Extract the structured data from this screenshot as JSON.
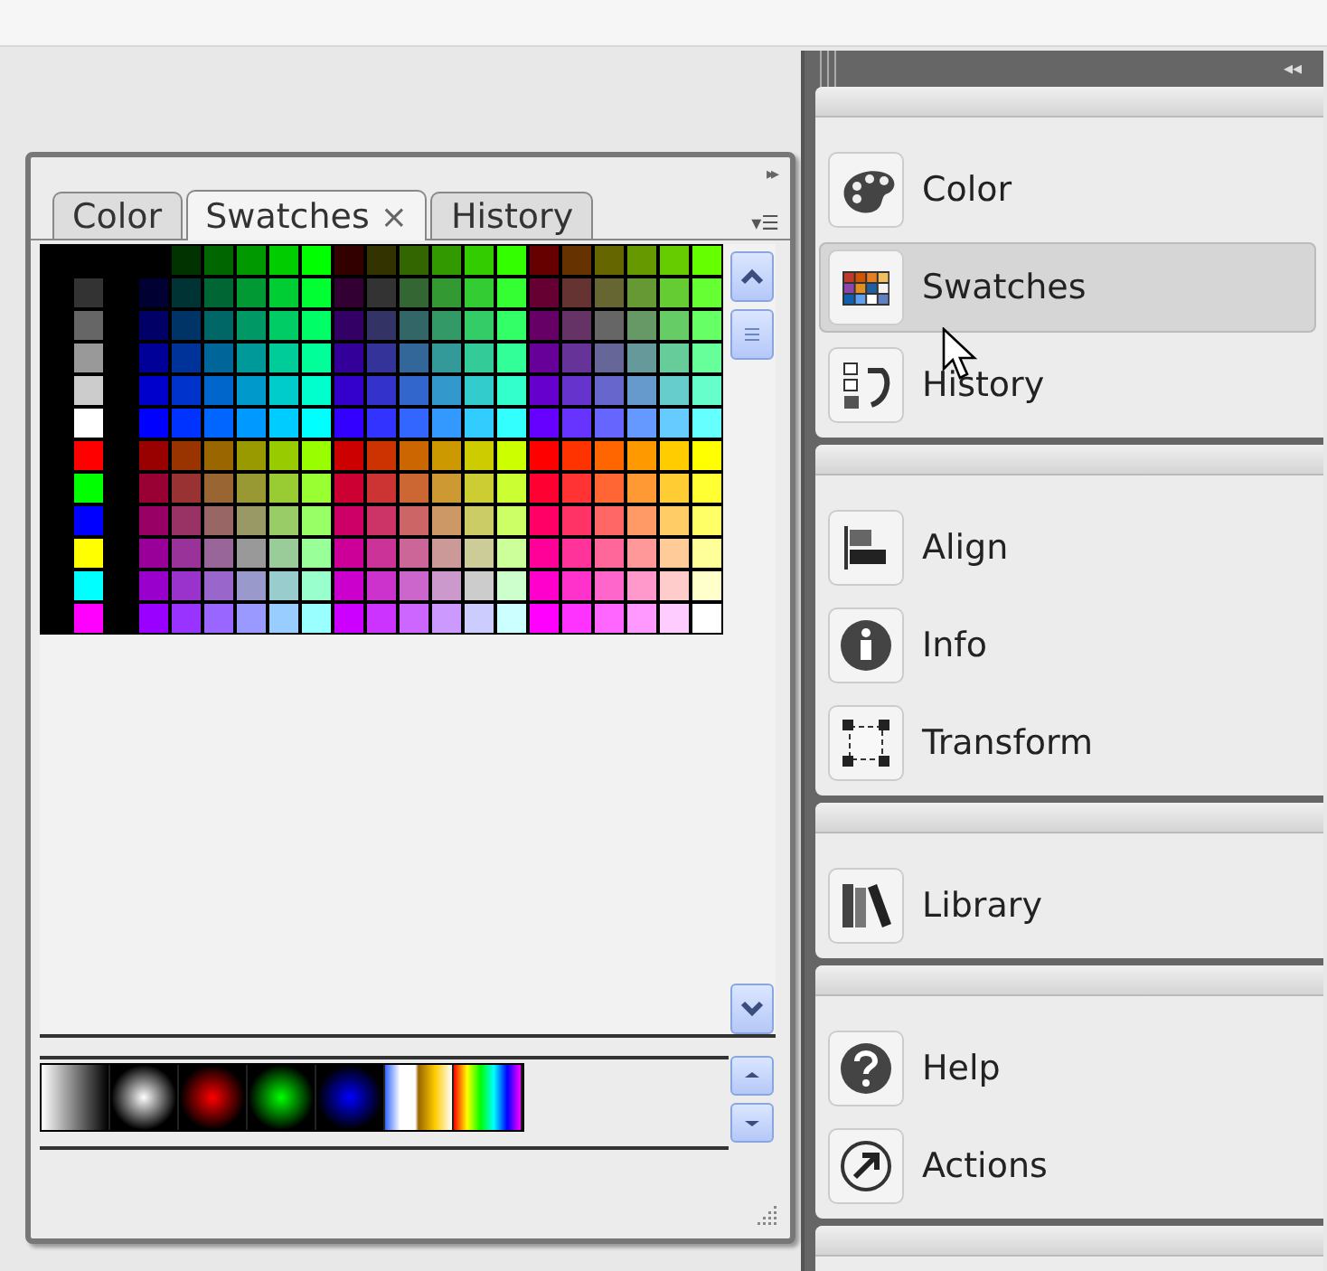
{
  "swatches_panel": {
    "collapse_glyph": "▸▸",
    "menu_glyph": "▾☰",
    "tabs": [
      {
        "label": "Color",
        "selected": false
      },
      {
        "label": "Swatches",
        "selected": true,
        "close": "×"
      },
      {
        "label": "History",
        "selected": false
      }
    ],
    "swatch_rows": [
      {
        "swatches": [
          {
            "color": "#003300"
          },
          {
            "color": "#006600"
          },
          {
            "color": "#009900"
          },
          {
            "color": "#00cc00"
          },
          {
            "color": "#00ff00"
          },
          {
            "color": "#330000"
          },
          {
            "color": "#333300"
          },
          {
            "color": "#336600"
          },
          {
            "color": "#339900"
          },
          {
            "color": "#33cc00"
          },
          {
            "color": "#33ff00"
          },
          {
            "color": "#660000"
          },
          {
            "color": "#663300"
          },
          {
            "color": "#666600"
          },
          {
            "color": "#669900"
          },
          {
            "color": "#66cc00"
          },
          {
            "color": "#66ff00"
          }
        ]
      },
      {
        "side": {
          "color": "#333333"
        },
        "swatches": [
          {
            "color": "#000033"
          },
          {
            "color": "#003333"
          },
          {
            "color": "#006633"
          },
          {
            "color": "#009933"
          },
          {
            "color": "#00cc33"
          },
          {
            "color": "#00ff33"
          },
          {
            "color": "#330033"
          },
          {
            "color": "#333333"
          },
          {
            "color": "#336633"
          },
          {
            "color": "#339933"
          },
          {
            "color": "#33cc33"
          },
          {
            "color": "#33ff33"
          },
          {
            "color": "#660033"
          },
          {
            "color": "#663333"
          },
          {
            "color": "#666633"
          },
          {
            "color": "#669933"
          },
          {
            "color": "#66cc33"
          },
          {
            "color": "#66ff33"
          }
        ]
      },
      {
        "side": {
          "color": "#666666"
        },
        "swatches": [
          {
            "color": "#000066"
          },
          {
            "color": "#003366"
          },
          {
            "color": "#006666"
          },
          {
            "color": "#009966"
          },
          {
            "color": "#00cc66"
          },
          {
            "color": "#00ff66"
          },
          {
            "color": "#330066"
          },
          {
            "color": "#333366"
          },
          {
            "color": "#336666"
          },
          {
            "color": "#339966"
          },
          {
            "color": "#33cc66"
          },
          {
            "color": "#33ff66"
          },
          {
            "color": "#660066"
          },
          {
            "color": "#663366"
          },
          {
            "color": "#666666"
          },
          {
            "color": "#669966"
          },
          {
            "color": "#66cc66"
          },
          {
            "color": "#66ff66"
          }
        ]
      },
      {
        "side": {
          "color": "#999999"
        },
        "swatches": [
          {
            "color": "#000099"
          },
          {
            "color": "#003399"
          },
          {
            "color": "#006699"
          },
          {
            "color": "#009999"
          },
          {
            "color": "#00cc99"
          },
          {
            "color": "#00ff99"
          },
          {
            "color": "#330099"
          },
          {
            "color": "#333399"
          },
          {
            "color": "#336699"
          },
          {
            "color": "#339999"
          },
          {
            "color": "#33cc99"
          },
          {
            "color": "#33ff99"
          },
          {
            "color": "#660099"
          },
          {
            "color": "#663399"
          },
          {
            "color": "#666699"
          },
          {
            "color": "#669999"
          },
          {
            "color": "#66cc99"
          },
          {
            "color": "#66ff99"
          }
        ]
      },
      {
        "side": {
          "color": "#cccccc"
        },
        "swatches": [
          {
            "color": "#0000cc"
          },
          {
            "color": "#0033cc"
          },
          {
            "color": "#0066cc"
          },
          {
            "color": "#0099cc"
          },
          {
            "color": "#00cccc"
          },
          {
            "color": "#00ffcc"
          },
          {
            "color": "#3300cc"
          },
          {
            "color": "#3333cc"
          },
          {
            "color": "#3366cc"
          },
          {
            "color": "#3399cc"
          },
          {
            "color": "#33cccc"
          },
          {
            "color": "#33ffcc"
          },
          {
            "color": "#6600cc"
          },
          {
            "color": "#6633cc"
          },
          {
            "color": "#6666cc"
          },
          {
            "color": "#6699cc"
          },
          {
            "color": "#66cccc"
          },
          {
            "color": "#66ffcc"
          }
        ]
      },
      {
        "side": {
          "color": "#ffffff"
        },
        "swatches": [
          {
            "color": "#0000ff"
          },
          {
            "color": "#0033ff"
          },
          {
            "color": "#0066ff"
          },
          {
            "color": "#0099ff"
          },
          {
            "color": "#00ccff"
          },
          {
            "color": "#00ffff"
          },
          {
            "color": "#3300ff"
          },
          {
            "color": "#3333ff"
          },
          {
            "color": "#3366ff"
          },
          {
            "color": "#3399ff"
          },
          {
            "color": "#33ccff"
          },
          {
            "color": "#33ffff"
          },
          {
            "color": "#6600ff"
          },
          {
            "color": "#6633ff"
          },
          {
            "color": "#6666ff"
          },
          {
            "color": "#6699ff"
          },
          {
            "color": "#66ccff"
          },
          {
            "color": "#66ffff"
          }
        ]
      },
      {
        "side": {
          "color": "#ff0000"
        },
        "swatches": [
          {
            "color": "#990000"
          },
          {
            "color": "#993300"
          },
          {
            "color": "#996600"
          },
          {
            "color": "#999900"
          },
          {
            "color": "#99cc00"
          },
          {
            "color": "#99ff00"
          },
          {
            "color": "#cc0000"
          },
          {
            "color": "#cc3300"
          },
          {
            "color": "#cc6600"
          },
          {
            "color": "#cc9900"
          },
          {
            "color": "#cccc00"
          },
          {
            "color": "#ccff00"
          },
          {
            "color": "#ff0000"
          },
          {
            "color": "#ff3300"
          },
          {
            "color": "#ff6600"
          },
          {
            "color": "#ff9900"
          },
          {
            "color": "#ffcc00"
          },
          {
            "color": "#ffff00"
          }
        ]
      },
      {
        "side": {
          "color": "#00ff00"
        },
        "swatches": [
          {
            "color": "#990033"
          },
          {
            "color": "#993333"
          },
          {
            "color": "#996633"
          },
          {
            "color": "#999933"
          },
          {
            "color": "#99cc33"
          },
          {
            "color": "#99ff33"
          },
          {
            "color": "#cc0033"
          },
          {
            "color": "#cc3333"
          },
          {
            "color": "#cc6633"
          },
          {
            "color": "#cc9933"
          },
          {
            "color": "#cccc33"
          },
          {
            "color": "#ccff33"
          },
          {
            "color": "#ff0033"
          },
          {
            "color": "#ff3333"
          },
          {
            "color": "#ff6633"
          },
          {
            "color": "#ff9933"
          },
          {
            "color": "#ffcc33"
          },
          {
            "color": "#ffff33"
          }
        ]
      },
      {
        "side": {
          "color": "#0000ff"
        },
        "swatches": [
          {
            "color": "#990066"
          },
          {
            "color": "#993366"
          },
          {
            "color": "#996666"
          },
          {
            "color": "#999966"
          },
          {
            "color": "#99cc66"
          },
          {
            "color": "#99ff66"
          },
          {
            "color": "#cc0066"
          },
          {
            "color": "#cc3366"
          },
          {
            "color": "#cc6666"
          },
          {
            "color": "#cc9966"
          },
          {
            "color": "#cccc66"
          },
          {
            "color": "#ccff66"
          },
          {
            "color": "#ff0066"
          },
          {
            "color": "#ff3366"
          },
          {
            "color": "#ff6666"
          },
          {
            "color": "#ff9966"
          },
          {
            "color": "#ffcc66"
          },
          {
            "color": "#ffff66"
          }
        ]
      },
      {
        "side": {
          "color": "#ffff00"
        },
        "swatches": [
          {
            "color": "#990099"
          },
          {
            "color": "#993399"
          },
          {
            "color": "#996699"
          },
          {
            "color": "#999999"
          },
          {
            "color": "#99cc99"
          },
          {
            "color": "#99ff99"
          },
          {
            "color": "#cc0099"
          },
          {
            "color": "#cc3399"
          },
          {
            "color": "#cc6699"
          },
          {
            "color": "#cc9999"
          },
          {
            "color": "#cccc99"
          },
          {
            "color": "#ccff99"
          },
          {
            "color": "#ff0099"
          },
          {
            "color": "#ff3399"
          },
          {
            "color": "#ff6699"
          },
          {
            "color": "#ff9999"
          },
          {
            "color": "#ffcc99"
          },
          {
            "color": "#ffff99"
          }
        ]
      },
      {
        "side": {
          "color": "#00ffff"
        },
        "swatches": [
          {
            "color": "#9900cc"
          },
          {
            "color": "#9933cc"
          },
          {
            "color": "#9966cc"
          },
          {
            "color": "#9999cc"
          },
          {
            "color": "#99cccc"
          },
          {
            "color": "#99ffcc"
          },
          {
            "color": "#cc00cc"
          },
          {
            "color": "#cc33cc"
          },
          {
            "color": "#cc66cc"
          },
          {
            "color": "#cc99cc"
          },
          {
            "color": "#cccccc"
          },
          {
            "color": "#ccffcc"
          },
          {
            "color": "#ff00cc"
          },
          {
            "color": "#ff33cc"
          },
          {
            "color": "#ff66cc"
          },
          {
            "color": "#ff99cc"
          },
          {
            "color": "#ffcccc"
          },
          {
            "color": "#ffffcc"
          }
        ]
      },
      {
        "side": {
          "color": "#ff00ff"
        },
        "swatches": [
          {
            "color": "#9900ff"
          },
          {
            "color": "#9933ff"
          },
          {
            "color": "#9966ff"
          },
          {
            "color": "#9999ff"
          },
          {
            "color": "#99ccff"
          },
          {
            "color": "#99ffff"
          },
          {
            "color": "#cc00ff"
          },
          {
            "color": "#cc33ff"
          },
          {
            "color": "#cc66ff"
          },
          {
            "color": "#cc99ff"
          },
          {
            "color": "#ccccff"
          },
          {
            "color": "#ccffff"
          },
          {
            "color": "#ff00ff"
          },
          {
            "color": "#ff33ff"
          },
          {
            "color": "#ff66ff"
          },
          {
            "color": "#ff99ff"
          },
          {
            "color": "#ffccff"
          },
          {
            "color": "#ffffff"
          }
        ]
      }
    ]
  },
  "dock": {
    "collapse_glyph": "◂◂",
    "groups": [
      {
        "items": [
          {
            "label": "Color",
            "selected": false
          },
          {
            "label": "Swatches",
            "selected": true
          },
          {
            "label": "History",
            "selected": false
          }
        ]
      },
      {
        "items": [
          {
            "label": "Align",
            "selected": false
          },
          {
            "label": "Info",
            "selected": false
          },
          {
            "label": "Transform",
            "selected": false
          }
        ]
      },
      {
        "items": [
          {
            "label": "Library",
            "selected": false
          }
        ]
      },
      {
        "items": [
          {
            "label": "Help",
            "selected": false
          },
          {
            "label": "Actions",
            "selected": false
          }
        ]
      }
    ]
  }
}
